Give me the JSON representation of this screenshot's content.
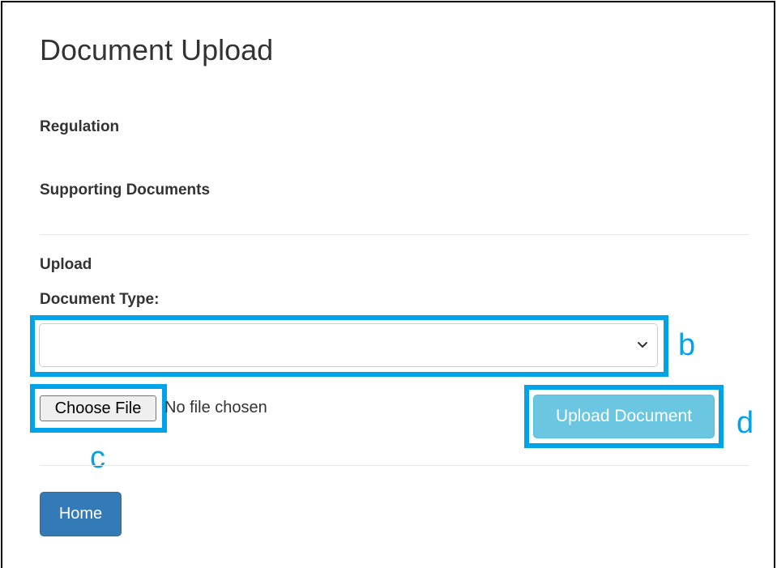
{
  "page": {
    "title": "Document Upload"
  },
  "sections": {
    "regulation_label": "Regulation",
    "supporting_docs_label": "Supporting Documents",
    "upload_label": "Upload",
    "doc_type_label": "Document Type:"
  },
  "document_type_select": {
    "selected_value": "",
    "chevron_icon": "chevron-down-icon"
  },
  "file_input": {
    "button_label": "Choose File",
    "status_text": "No file chosen"
  },
  "actions": {
    "upload_label": "Upload Document",
    "home_label": "Home"
  },
  "annotations": {
    "b": "b",
    "c": "c",
    "d": "d"
  },
  "colors": {
    "annotation": "#00a2e8",
    "upload_button": "#5bc0de",
    "home_button": "#337ab7"
  }
}
